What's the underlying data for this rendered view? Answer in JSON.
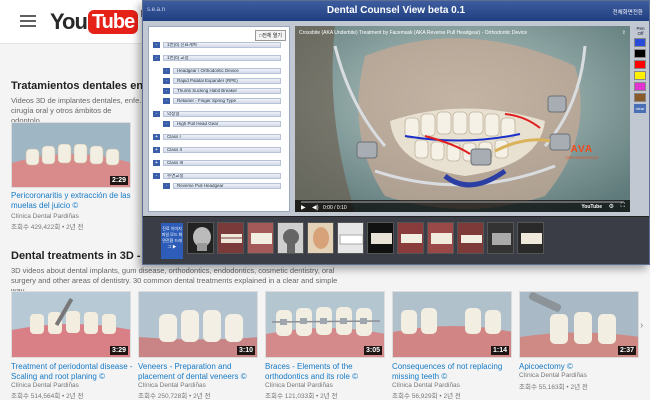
{
  "youtube": {
    "logo_you": "You",
    "logo_tube": "Tube",
    "region": "KR",
    "section1": {
      "title": "Tratamientos dentales en 3D - C",
      "description": "Videos 3D de implantes dentales, enfe... cirugía oral y otros ámbitos de odontolo..."
    },
    "featured_video": {
      "title": "Pericoronaritis y extracción de las muelas del juicio ©",
      "channel": "Clínica Dental Pardiñas",
      "meta": "조회수 429,422회 • 2년 전",
      "duration": "2:29"
    },
    "section2": {
      "title": "Dental treatments in 3D - Dentis",
      "description": "3D videos about dental implants, gum disease, orthodontics, endodontics, cosmetic dentistry, oral surgery and other areas of dentistry. 30 common dental treatments explained in a clear and simple way,..."
    },
    "videos": [
      {
        "title": "Treatment of periodontal disease - Scaling and root planing ©",
        "channel": "Clínica Dental Pardiñas",
        "meta": "조회수 514,564회 • 2년 전",
        "duration": "3:29"
      },
      {
        "title": "Veneers - Preparation and placement of dental veneers ©",
        "channel": "Clínica Dental Pardiñas",
        "meta": "조회수 250,728회 • 2년 전",
        "duration": "3:10"
      },
      {
        "title": "Braces - Elements of the orthodontics and its role ©",
        "channel": "Clínica Dental Pardiñas",
        "meta": "조회수 121,033회 • 2년 전",
        "duration": "3:05"
      },
      {
        "title": "Consequences of not replacing missing teeth ©",
        "channel": "Clínica Dental Pardiñas",
        "meta": "조회수 56,929회 • 2년 전",
        "duration": "1:14"
      },
      {
        "title": "Apicoectomy ©",
        "channel": "Clínica Dental Pardiñas",
        "meta": "조회수 55,163회 • 2년 전",
        "duration": "2:37"
      }
    ]
  },
  "dental_counsel": {
    "app_name": "s.e.a.n",
    "title": "Dental Counsel View beta 0.1",
    "fullscreen_label": "전체화면전환",
    "tree_button": "□전체 열기",
    "tree": [
      {
        "label": "1번(0) 진료계획",
        "indent": 0
      },
      {
        "label": "1번(0) 교정",
        "indent": 0
      },
      {
        "label": "Headgear / Orthodontic Device",
        "indent": 1
      },
      {
        "label": "Rapid Palatal Expander (RPE)",
        "indent": 1
      },
      {
        "label": "Thumb Sucking Habit Breaker",
        "indent": 1
      },
      {
        "label": "Retainer - Finger Spring Type",
        "indent": 1
      },
      {
        "label": "악정형",
        "indent": 0
      },
      {
        "label": "High Pull Head Gear",
        "indent": 1
      },
      {
        "label": "Class I",
        "indent": 0
      },
      {
        "label": "Class II",
        "indent": 0
      },
      {
        "label": "Class III",
        "indent": 0
      },
      {
        "label": "수면교정",
        "indent": 0
      },
      {
        "label": "Reverse Pull Headgear",
        "indent": 1
      }
    ],
    "video": {
      "title": "Crossbite (AKA Underbite) Treatment by Facemask (AKA Reverse Pull Headgear) - Orthodontic Device",
      "share_label": "⇪",
      "time": "0:00 / 0:10",
      "youtube_mark": "YouTube",
      "brand_main": "AVA",
      "brand_sub": "ORTHODONTICS",
      "progress": 0.0
    },
    "palette": {
      "label": "Pen Off",
      "colors": [
        "#2a4bd8",
        "#000000",
        "#ff0000",
        "#ffee00",
        "#e033d0",
        "#8b5a2b"
      ],
      "reset_label": "clear"
    },
    "strip_button": "진료 이미지파일 모드 화면전환 드래그 ▶"
  }
}
